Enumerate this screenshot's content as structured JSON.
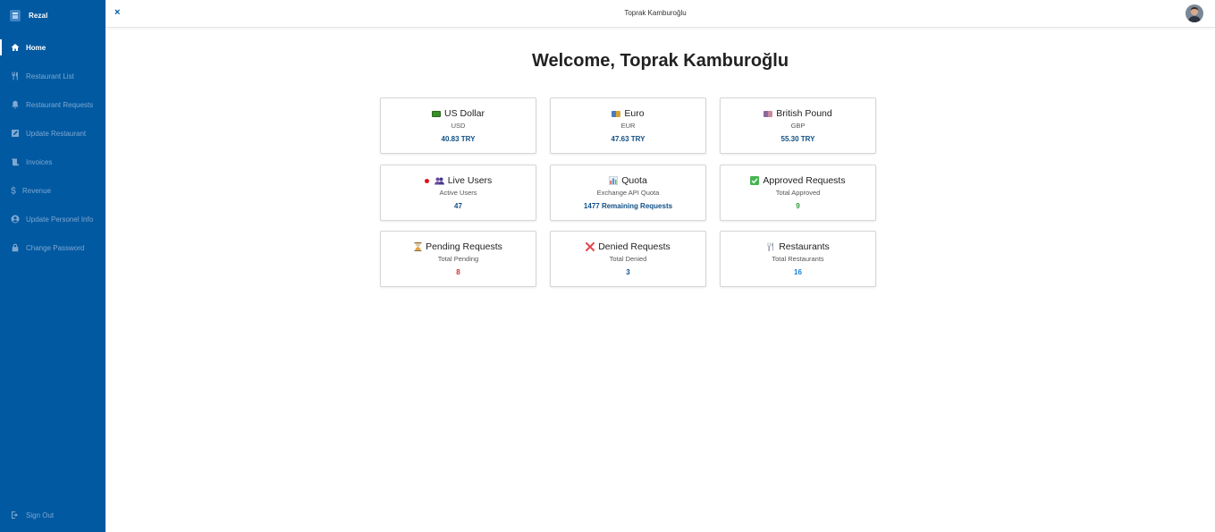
{
  "app": {
    "brand": "Rezal"
  },
  "sidebar": {
    "items": [
      {
        "label": "Home",
        "icon": "home-icon",
        "active": true
      },
      {
        "label": "Restaurant List",
        "icon": "utensils-icon"
      },
      {
        "label": "Restaurant Requests",
        "icon": "bell-icon"
      },
      {
        "label": "Update Restaurant",
        "icon": "edit-icon"
      },
      {
        "label": "Invoices",
        "icon": "receipt-icon"
      },
      {
        "label": "Revenue",
        "icon": "dollar-icon"
      },
      {
        "label": "Update Personel Info",
        "icon": "user-circle-icon"
      },
      {
        "label": "Change Password",
        "icon": "lock-icon"
      }
    ],
    "signout": {
      "label": "Sign Out",
      "icon": "sign-out-icon"
    }
  },
  "topbar": {
    "title": "Toprak Kamburoğlu",
    "close_icon": "×"
  },
  "main": {
    "welcome": "Welcome, Toprak Kamburoğlu",
    "cards": [
      {
        "title": "US Dollar",
        "subtitle": "USD",
        "value": "40.83 TRY",
        "icon": "us-flag-icon"
      },
      {
        "title": "Euro",
        "subtitle": "EUR",
        "value": "47.63 TRY",
        "icon": "eu-flag-icon"
      },
      {
        "title": "British Pound",
        "subtitle": "GBP",
        "value": "55.30 TRY",
        "icon": "uk-flag-icon"
      },
      {
        "title": "Live Users",
        "subtitle": "Active Users",
        "value": "47",
        "icon": "users-icon"
      },
      {
        "title": "Quota",
        "subtitle": "Exchange API Quota",
        "value": "1477 Remaining Requests",
        "icon": "bar-chart-icon"
      },
      {
        "title": "Approved Requests",
        "subtitle": "Total Approved",
        "value": "9",
        "icon": "check-icon",
        "value_color": "#2e9a3a"
      },
      {
        "title": "Pending Requests",
        "subtitle": "Total Pending",
        "value": "8",
        "icon": "hourglass-icon",
        "value_color": "#d32f2f"
      },
      {
        "title": "Denied Requests",
        "subtitle": "Total Denied",
        "value": "3",
        "icon": "cross-icon"
      },
      {
        "title": "Restaurants",
        "subtitle": "Total Restaurants",
        "value": "16",
        "icon": "fork-knife-icon",
        "value_color": "#1b7fd0"
      }
    ]
  },
  "colors": {
    "sidebar": "#0059a1",
    "accent": "#0f4f86"
  }
}
